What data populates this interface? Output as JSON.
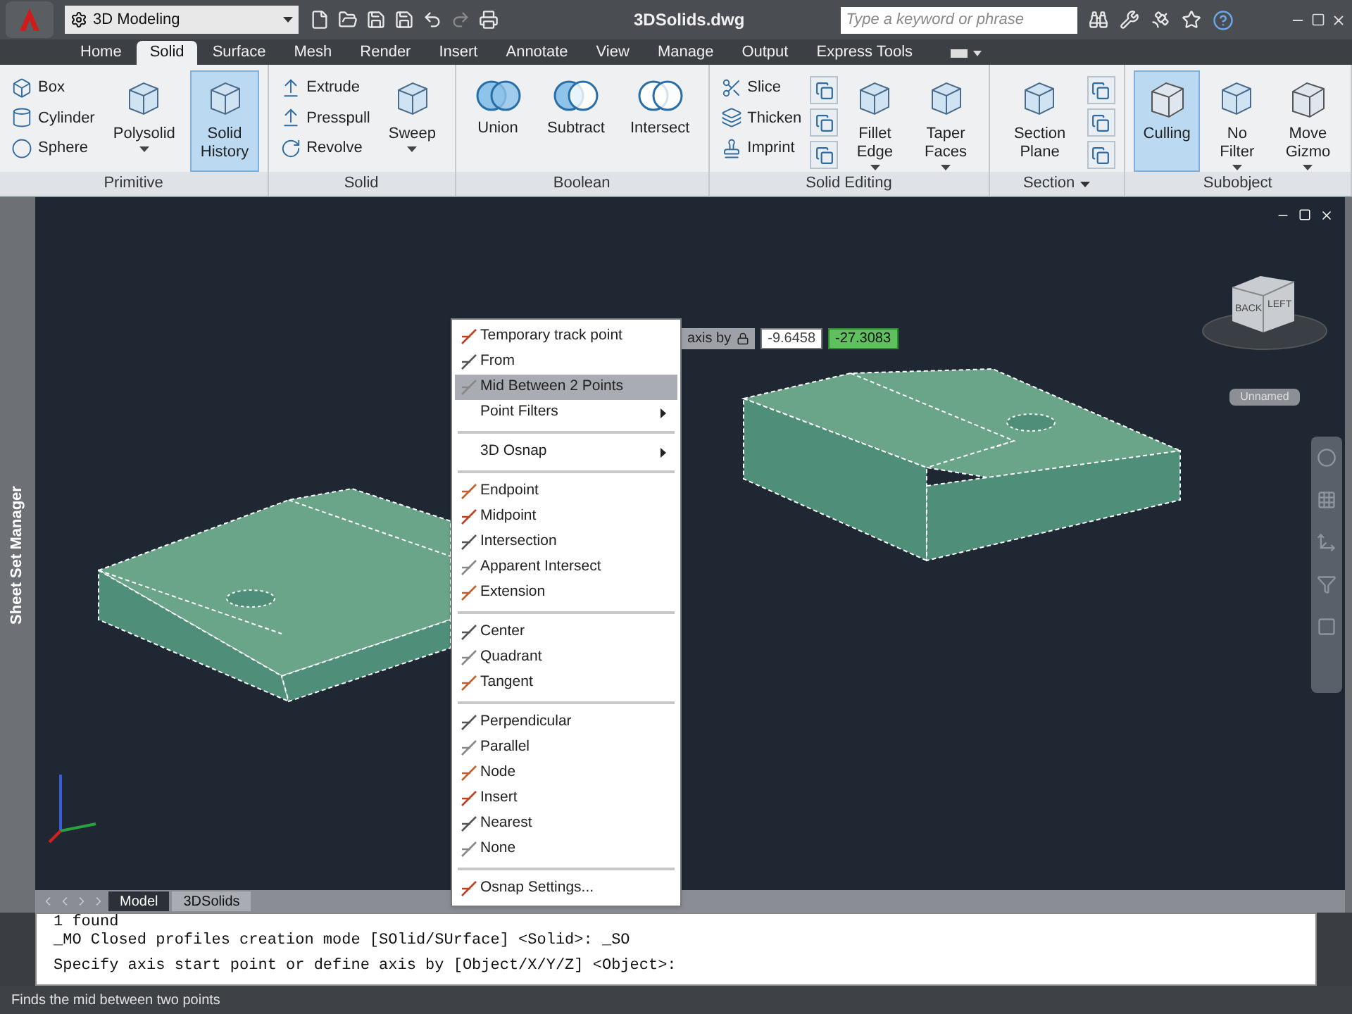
{
  "title_bar": {
    "workspace": "3D Modeling",
    "title": "3DSolids.dwg",
    "search": {
      "placeholder": "Type a keyword or phrase"
    }
  },
  "ribbon_tabs": [
    {
      "label": "Home",
      "selected": false
    },
    {
      "label": "Solid",
      "selected": true
    },
    {
      "label": "Surface",
      "selected": false
    },
    {
      "label": "Mesh",
      "selected": false
    },
    {
      "label": "Render",
      "selected": false
    },
    {
      "label": "Insert",
      "selected": false
    },
    {
      "label": "Annotate",
      "selected": false
    },
    {
      "label": "View",
      "selected": false
    },
    {
      "label": "Manage",
      "selected": false
    },
    {
      "label": "Output",
      "selected": false
    },
    {
      "label": "Express Tools",
      "selected": false
    }
  ],
  "ribbon_panels": [
    {
      "title": "Primitive",
      "title_dropdown": false,
      "controls": [
        {
          "kind": "stack",
          "items": [
            "Box",
            "Cylinder",
            "Sphere"
          ]
        },
        {
          "kind": "large",
          "label": "Polysolid",
          "dropdown": true,
          "selected": false
        },
        {
          "kind": "large",
          "label": "Solid History",
          "dropdown": false,
          "selected": true
        }
      ]
    },
    {
      "title": "Solid",
      "title_dropdown": false,
      "controls": [
        {
          "kind": "stack",
          "items": [
            "Extrude",
            "Presspull",
            "Revolve"
          ]
        },
        {
          "kind": "large",
          "label": "Sweep",
          "dropdown": true,
          "selected": false
        }
      ]
    },
    {
      "title": "Boolean",
      "title_dropdown": false,
      "controls": [
        {
          "kind": "large",
          "label": "Union",
          "dropdown": false,
          "selected": false
        },
        {
          "kind": "large",
          "label": "Subtract",
          "dropdown": false,
          "selected": false
        },
        {
          "kind": "large",
          "label": "Intersect",
          "dropdown": false,
          "selected": false
        }
      ]
    },
    {
      "title": "Solid Editing",
      "title_dropdown": false,
      "controls": [
        {
          "kind": "stack",
          "items": [
            "Slice",
            "Thicken",
            "Imprint"
          ]
        },
        {
          "kind": "icon_column"
        },
        {
          "kind": "large",
          "label": "Fillet Edge",
          "dropdown": true,
          "selected": false
        },
        {
          "kind": "large",
          "label": "Taper Faces",
          "dropdown": true,
          "selected": false
        }
      ]
    },
    {
      "title": "Section",
      "title_dropdown": true,
      "controls": [
        {
          "kind": "large",
          "label": "Section Plane",
          "dropdown": false,
          "selected": false
        },
        {
          "kind": "icon_column"
        }
      ]
    },
    {
      "title": "Subobject",
      "title_dropdown": false,
      "controls": [
        {
          "kind": "large",
          "label": "Culling",
          "dropdown": false,
          "selected": true
        },
        {
          "kind": "large",
          "label": "No Filter",
          "dropdown": true,
          "selected": false
        },
        {
          "kind": "large",
          "label": "Move Gizmo",
          "dropdown": true,
          "selected": false
        }
      ]
    }
  ],
  "side_palette": {
    "title": "Sheet Set Manager"
  },
  "dynamic_input": {
    "prompt": "axis by",
    "fields": [
      {
        "value": "-9.6458",
        "selected": false
      },
      {
        "value": "-27.3083",
        "selected": true
      }
    ]
  },
  "viewcube": {
    "faces": [
      "BACK",
      "LEFT"
    ],
    "view_name": "Unnamed"
  },
  "context_menu": {
    "items": [
      {
        "kind": "item",
        "label": "Temporary track point",
        "selected": false
      },
      {
        "kind": "item",
        "label": "From",
        "selected": false
      },
      {
        "kind": "item",
        "label": "Mid Between 2 Points",
        "selected": true
      },
      {
        "kind": "submenu",
        "label": "Point Filters",
        "selected": false
      },
      {
        "kind": "separator"
      },
      {
        "kind": "submenu",
        "label": "3D Osnap",
        "selected": false
      },
      {
        "kind": "separator"
      },
      {
        "kind": "item",
        "label": "Endpoint",
        "selected": false
      },
      {
        "kind": "item",
        "label": "Midpoint",
        "selected": false
      },
      {
        "kind": "item",
        "label": "Intersection",
        "selected": false
      },
      {
        "kind": "item",
        "label": "Apparent Intersect",
        "selected": false
      },
      {
        "kind": "item",
        "label": "Extension",
        "selected": false
      },
      {
        "kind": "separator"
      },
      {
        "kind": "item",
        "label": "Center",
        "selected": false
      },
      {
        "kind": "item",
        "label": "Quadrant",
        "selected": false
      },
      {
        "kind": "item",
        "label": "Tangent",
        "selected": false
      },
      {
        "kind": "separator"
      },
      {
        "kind": "item",
        "label": "Perpendicular",
        "selected": false
      },
      {
        "kind": "item",
        "label": "Parallel",
        "selected": false
      },
      {
        "kind": "item",
        "label": "Node",
        "selected": false
      },
      {
        "kind": "item",
        "label": "Insert",
        "selected": false
      },
      {
        "kind": "item",
        "label": "Nearest",
        "selected": false
      },
      {
        "kind": "item",
        "label": "None",
        "selected": false
      },
      {
        "kind": "separator"
      },
      {
        "kind": "item",
        "label": "Osnap Settings...",
        "selected": false
      }
    ]
  },
  "layout_tabs": [
    {
      "label": "Model",
      "selected": true
    },
    {
      "label": "3DSolids",
      "selected": false
    }
  ],
  "command_history": [
    "1 found",
    "_MO Closed profiles creation mode [SOlid/SUrface] <Solid>: _SO"
  ],
  "command_line": "Specify axis start point or define axis by [Object/X/Y/Z] <Object>:",
  "status_bar": {
    "text": "Finds the mid between two points"
  }
}
